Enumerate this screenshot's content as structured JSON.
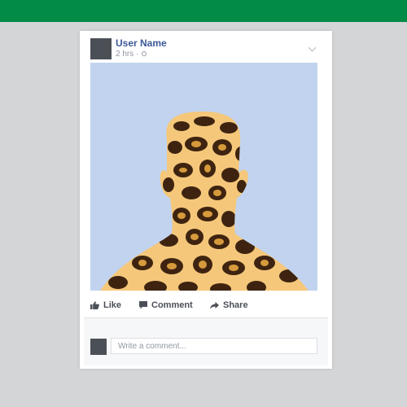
{
  "post": {
    "user_name": "User Name",
    "time": "2 hrs ·",
    "privacy_icon": "globe-icon",
    "menu_icon": "chevron-down-icon"
  },
  "image": {
    "subject": "Leopard-print silhouette of a person",
    "background_color": "#c1d3ee",
    "pattern_base": "#f5c77a",
    "pattern_spot": "#3e2410",
    "pattern_highlight": "#d69a3c"
  },
  "actions": {
    "like": {
      "label": "Like",
      "icon": "thumbs-up-icon"
    },
    "comment": {
      "label": "Comment",
      "icon": "speech-bubble-icon"
    },
    "share": {
      "label": "Share",
      "icon": "share-arrow-icon"
    }
  },
  "comment_box": {
    "placeholder": "Write a comment...",
    "value": ""
  },
  "colors": {
    "top_bar": "#028b47",
    "page_background": "#d4d5d7",
    "link": "#3b5998"
  }
}
